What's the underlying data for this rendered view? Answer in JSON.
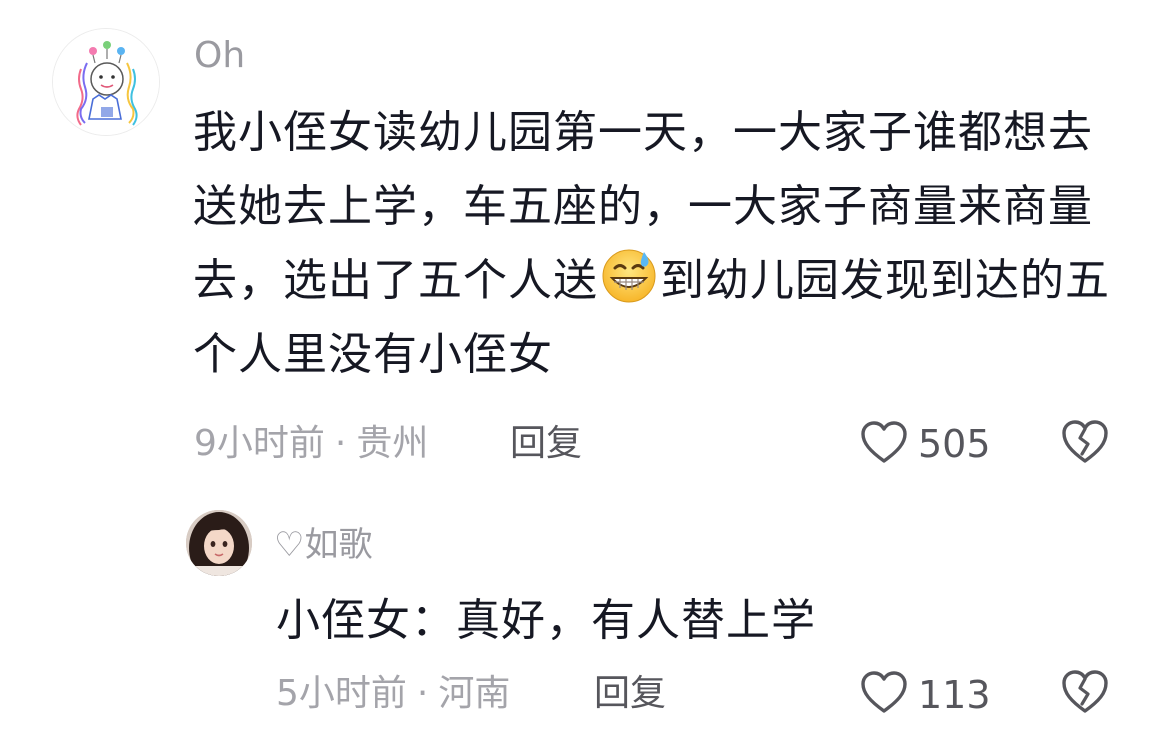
{
  "comments": [
    {
      "username": "Oh",
      "text_before_emoji": "我小侄女读幼儿园第一天，一大家子谁都想去送她去上学，车五座的，一大家子商量来商量去，选出了五个人送",
      "emoji": "grinning-sweat-emoji",
      "text_after_emoji": "到幼儿园发现到达的五个人里没有小侄女",
      "time": "9小时前",
      "separator": "·",
      "location": "贵州",
      "reply_label": "回复",
      "like_count": "505"
    },
    {
      "username": "♡如歌",
      "text": "小侄女：真好，有人替上学",
      "time": "5小时前",
      "separator": "·",
      "location": "河南",
      "reply_label": "回复",
      "like_count": "113"
    }
  ],
  "icons": {
    "like": "heart-outline-icon",
    "dislike": "broken-heart-icon"
  },
  "colors": {
    "text": "#161823",
    "muted": "#a4a4aa",
    "action": "#56565c"
  }
}
